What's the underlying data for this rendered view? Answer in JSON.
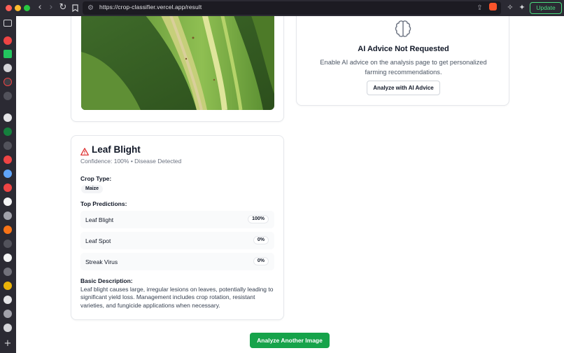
{
  "browser": {
    "url": "https://crop-classifier.vercel.app/result",
    "update_label": "Update",
    "icons": [
      "back-icon",
      "forward-icon",
      "reload-icon",
      "bookmark-icon",
      "site-settings-icon",
      "share-icon",
      "brave-shield-icon",
      "extensions-icon",
      "leo-ai-icon"
    ],
    "sidebar_icons": [
      "sidebar-toggle-icon",
      "youtube-icon",
      "sheets-icon",
      "github-icon",
      "chatgpt-icon",
      "add-icon"
    ]
  },
  "image_card": {
    "image_alt_icon": "leaf-photo"
  },
  "advice": {
    "icon": "brain-icon",
    "title": "AI Advice Not Requested",
    "text": "Enable AI advice on the analysis page to get personalized farming recommendations.",
    "button": "Analyze with AI Advice"
  },
  "result": {
    "icon": "warning-triangle-icon",
    "title": "Leaf Blight",
    "confidence": "Confidence: 100% • Disease Detected",
    "crop_type_label": "Crop Type:",
    "crop_type": "Maize",
    "predictions_label": "Top Predictions:",
    "predictions": [
      {
        "name": "Leaf Blight",
        "value": "100%"
      },
      {
        "name": "Leaf Spot",
        "value": "0%"
      },
      {
        "name": "Streak Virus",
        "value": "0%"
      }
    ],
    "description_label": "Basic Description:",
    "description": "Leaf blight causes large, irregular lesions on leaves, potentially leading to significant yield loss. Management includes crop rotation, resistant varieties, and fungicide applications when necessary."
  },
  "footer": {
    "analyze_another": "Analyze Another Image"
  },
  "colors": {
    "accent": "#16a34a",
    "warning": "#dc2626",
    "chrome": "#2b2a33"
  }
}
